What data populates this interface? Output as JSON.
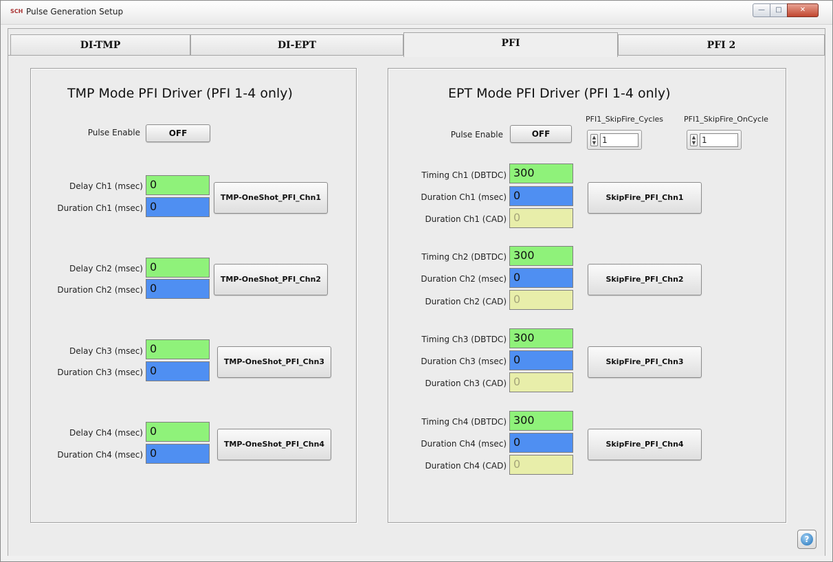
{
  "window": {
    "title": "Pulse Generation Setup",
    "app_icon": "SCH"
  },
  "tabs": [
    {
      "label": "DI-TMP",
      "active": false
    },
    {
      "label": "DI-EPT",
      "active": false
    },
    {
      "label": "PFI",
      "active": true
    },
    {
      "label": "PFI 2",
      "active": false
    }
  ],
  "tmp": {
    "title": "TMP Mode PFI Driver (PFI 1-4 only)",
    "pulse_enable_label": "Pulse Enable",
    "pulse_enable_value": "OFF",
    "channels": [
      {
        "delay_label": "Delay Ch1 (msec)",
        "delay_value": "0",
        "duration_label": "Duration Ch1 (msec)",
        "duration_value": "0",
        "button": "TMP-OneShot_PFI_Chn1"
      },
      {
        "delay_label": "Delay Ch2 (msec)",
        "delay_value": "0",
        "duration_label": "Duration Ch2 (msec)",
        "duration_value": "0",
        "button": "TMP-OneShot_PFI_Chn2"
      },
      {
        "delay_label": "Delay Ch3 (msec)",
        "delay_value": "0",
        "duration_label": "Duration Ch3 (msec)",
        "duration_value": "0",
        "button": "TMP-OneShot_PFI_Chn3"
      },
      {
        "delay_label": "Delay Ch4 (msec)",
        "delay_value": "0",
        "duration_label": "Duration Ch4 (msec)",
        "duration_value": "0",
        "button": "TMP-OneShot_PFI_Chn4"
      }
    ]
  },
  "ept": {
    "title": "EPT Mode PFI Driver (PFI 1-4 only)",
    "pulse_enable_label": "Pulse Enable",
    "pulse_enable_value": "OFF",
    "skipfire_cycles_label": "PFI1_SkipFire_Cycles",
    "skipfire_cycles_value": "1",
    "skipfire_oncycle_label": "PFI1_SkipFire_OnCycle",
    "skipfire_oncycle_value": "1",
    "channels": [
      {
        "timing_label": "Timing Ch1 (DBTDC)",
        "timing_value": "300",
        "duration_msec_label": "Duration Ch1 (msec)",
        "duration_msec_value": "0",
        "duration_cad_label": "Duration Ch1  (CAD)",
        "duration_cad_value": "0",
        "button": "SkipFire_PFI_Chn1"
      },
      {
        "timing_label": "Timing Ch2 (DBTDC)",
        "timing_value": "300",
        "duration_msec_label": "Duration Ch2 (msec)",
        "duration_msec_value": "0",
        "duration_cad_label": "Duration Ch2  (CAD)",
        "duration_cad_value": "0",
        "button": "SkipFire_PFI_Chn2"
      },
      {
        "timing_label": "Timing Ch3 (DBTDC)",
        "timing_value": "300",
        "duration_msec_label": "Duration Ch3 (msec)",
        "duration_msec_value": "0",
        "duration_cad_label": "Duration Ch3  (CAD)",
        "duration_cad_value": "0",
        "button": "SkipFire_PFI_Chn3"
      },
      {
        "timing_label": "Timing Ch4 (DBTDC)",
        "timing_value": "300",
        "duration_msec_label": "Duration Ch4 (msec)",
        "duration_msec_value": "0",
        "duration_cad_label": "Duration Ch4  (CAD)",
        "duration_cad_value": "0",
        "button": "SkipFire_PFI_Chn4"
      }
    ]
  },
  "colors": {
    "delay_field": "#8ff27a",
    "duration_field": "#4f8ff2",
    "cad_field": "#e8eeaa"
  },
  "icons": {
    "help": "help-icon",
    "minimize": "minimize-icon",
    "maximize": "maximize-icon",
    "close": "close-icon"
  }
}
